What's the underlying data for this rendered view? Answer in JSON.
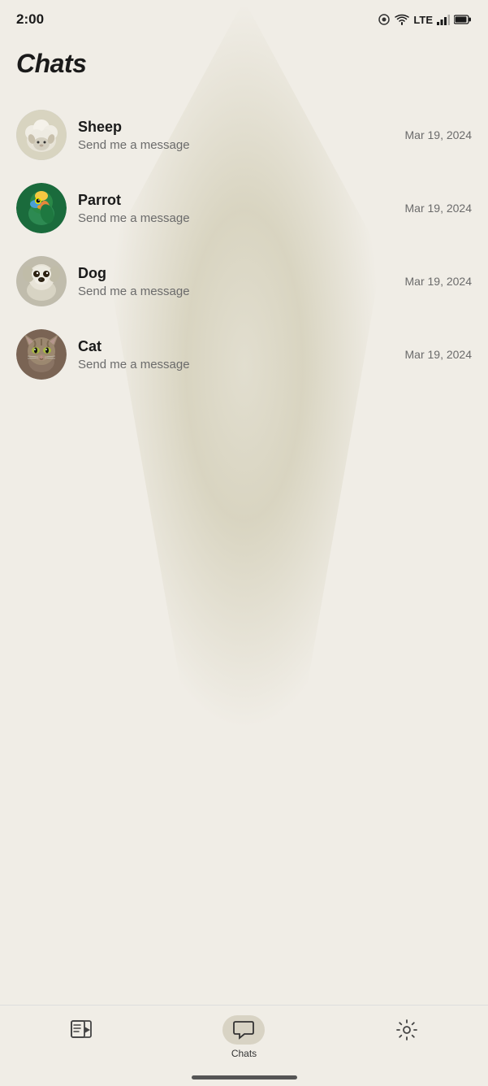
{
  "statusBar": {
    "time": "2:00",
    "cameraIcon": "camera-icon",
    "wifiIcon": "wifi-icon",
    "lteLabel": "LTE",
    "signalIcon": "signal-icon",
    "batteryIcon": "battery-icon"
  },
  "pageTitle": "Chats",
  "chats": [
    {
      "id": "sheep",
      "name": "Sheep",
      "preview": "Send me a message",
      "date": "Mar 19, 2024",
      "avatarColor1": "#f5f5f2",
      "avatarColor2": "#c8c4a8"
    },
    {
      "id": "parrot",
      "name": "Parrot",
      "preview": "Send me a message",
      "date": "Mar 19, 2024",
      "avatarColor1": "#2d8a52",
      "avatarColor2": "#f5c842"
    },
    {
      "id": "dog",
      "name": "Dog",
      "preview": "Send me a message",
      "date": "Mar 19, 2024",
      "avatarColor1": "#e8e4dc",
      "avatarColor2": "#a09c8c"
    },
    {
      "id": "cat",
      "name": "Cat",
      "preview": "Send me a message",
      "date": "Mar 19, 2024",
      "avatarColor1": "#9c8870",
      "avatarColor2": "#5a4840"
    }
  ],
  "bottomNav": {
    "items": [
      {
        "id": "media",
        "label": "",
        "icon": "media-icon",
        "active": false
      },
      {
        "id": "chats",
        "label": "Chats",
        "icon": "chat-icon",
        "active": true
      },
      {
        "id": "settings",
        "label": "",
        "icon": "settings-icon",
        "active": false
      }
    ]
  }
}
